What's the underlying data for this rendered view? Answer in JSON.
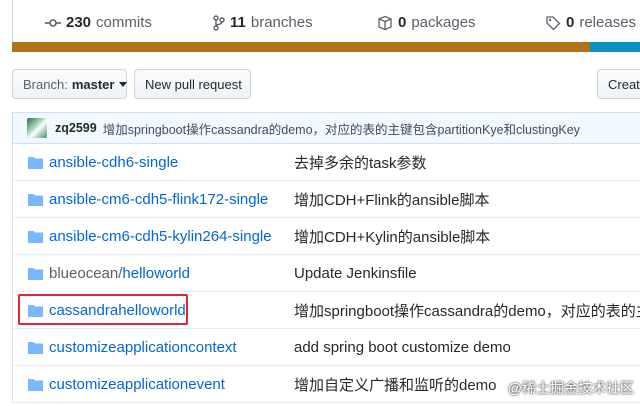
{
  "summary": {
    "commits": {
      "count": "230",
      "label": "commits",
      "icon": "history-icon"
    },
    "branches": {
      "count": "11",
      "label": "branches",
      "icon": "branch-icon"
    },
    "packages": {
      "count": "0",
      "label": "packages",
      "icon": "package-icon"
    },
    "releases": {
      "count": "0",
      "label": "releases",
      "icon": "tag-icon"
    }
  },
  "language_colors": {
    "primary": "#b07219",
    "secondary": "#0e90c4"
  },
  "toolbar": {
    "branch_prefix": "Branch:",
    "branch_name": "master",
    "new_pr_label": "New pull request",
    "create_label": "Create"
  },
  "latest_commit": {
    "author": "zq2599",
    "message": "增加springboot操作cassandra的demo，对应的表的主键包含partitionKye和clustingKey"
  },
  "files": [
    {
      "name": "ansible-cdh6-single",
      "message": "去掉多余的task参数"
    },
    {
      "name": "ansible-cm6-cdh5-flink172-single",
      "message": "增加CDH+Flink的ansible脚本"
    },
    {
      "name": "ansible-cm6-cdh5-kylin264-single",
      "message": "增加CDH+Kylin的ansible脚本"
    },
    {
      "name_prefix": "blueocean/",
      "name": "helloworld",
      "message": "Update Jenkinsfile"
    },
    {
      "name": "cassandrahelloworld",
      "message": "增加springboot操作cassandra的demo，对应的表的主键"
    },
    {
      "name": "customizeapplicationcontext",
      "message": "add spring boot customize demo"
    },
    {
      "name": "customizeapplicationevent",
      "message": "增加自定义广播和监听的demo"
    }
  ],
  "watermark": "@稀土掘金技术社区",
  "highlight_color": "#e0262d"
}
